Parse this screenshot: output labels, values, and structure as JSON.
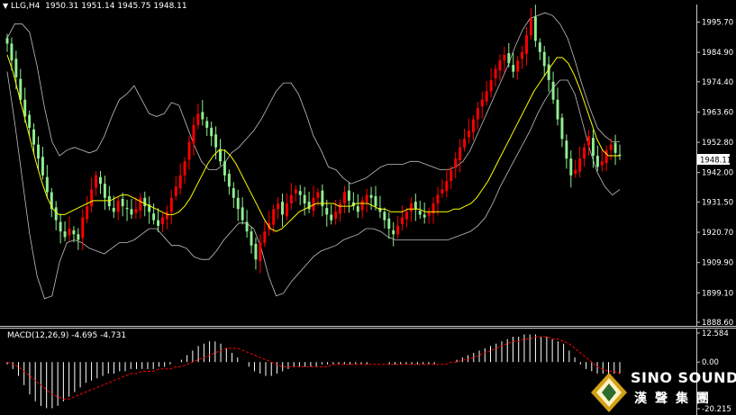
{
  "header": {
    "symbol": "LLG,H4",
    "ohlc": [
      "1950.31",
      "1951.14",
      "1945.75",
      "1948.11"
    ]
  },
  "macd": {
    "label": "MACD(12,26,9) -4.695 -4.731"
  },
  "current_price": "1948.11",
  "logo": {
    "title": "SINO SOUND",
    "subtitle": "漢聲集團"
  },
  "colors": {
    "background": "#000000",
    "bull_candle": "#ff0000",
    "bear_candle": "#90ee90",
    "ma_line": "#ffff00",
    "bollinger": "#c0c0c0",
    "macd_hist": "#ffffff",
    "macd_signal": "#ff0000"
  },
  "chart_data": [
    {
      "type": "candlestick",
      "title": "LLG,H4",
      "y_ticks": [
        "1995.70",
        "1984.90",
        "1974.40",
        "1963.60",
        "1952.80",
        "1942.00",
        "1931.50",
        "1920.70",
        "1909.90",
        "1899.10",
        "1888.60"
      ],
      "ylim": [
        1888.6,
        2001.0
      ],
      "x_labels": [],
      "series": [
        {
          "name": "Close",
          "values": [
            1988,
            1982,
            1976,
            1968,
            1962,
            1958,
            1952,
            1947,
            1941,
            1935,
            1929,
            1925,
            1921,
            1919,
            1922,
            1920,
            1918,
            1926,
            1930,
            1936,
            1941,
            1938,
            1933,
            1930,
            1928,
            1932,
            1930,
            1929,
            1927,
            1929,
            1933,
            1930,
            1928,
            1925,
            1923,
            1926,
            1928,
            1933,
            1937,
            1941,
            1946,
            1953,
            1959,
            1963,
            1961,
            1958,
            1955,
            1951,
            1946,
            1941,
            1937,
            1933,
            1929,
            1925,
            1921,
            1916,
            1911,
            1917,
            1921,
            1924,
            1929,
            1931,
            1927,
            1931,
            1934,
            1936,
            1934,
            1931,
            1929,
            1933,
            1935,
            1930,
            1927,
            1925,
            1928,
            1931,
            1935,
            1932,
            1930,
            1928,
            1932,
            1934,
            1933,
            1930,
            1928,
            1925,
            1922,
            1920,
            1923,
            1926,
            1928,
            1931,
            1929,
            1927,
            1926,
            1928,
            1931,
            1934,
            1936,
            1939,
            1943,
            1947,
            1951,
            1954,
            1957,
            1961,
            1965,
            1968,
            1971,
            1975,
            1979,
            1982,
            1984,
            1981,
            1978,
            1982,
            1985,
            1991,
            1997,
            1989,
            1985,
            1980,
            1975,
            1968,
            1961,
            1954,
            1947,
            1941,
            1943,
            1947,
            1951,
            1955,
            1948,
            1944,
            1946,
            1950,
            1952,
            1949,
            1948
          ]
        },
        {
          "name": "MA",
          "values": [
            1984,
            1978,
            1970,
            1962,
            1954,
            1946,
            1939,
            1933,
            1929,
            1927,
            1927,
            1928,
            1929,
            1930,
            1931,
            1932,
            1932,
            1932,
            1932,
            1933,
            1934,
            1934,
            1933,
            1932,
            1931,
            1930,
            1929,
            1928,
            1927,
            1927,
            1928,
            1930,
            1933,
            1937,
            1941,
            1945,
            1948,
            1950,
            1950,
            1948,
            1945,
            1941,
            1937,
            1933,
            1929,
            1925,
            1922,
            1921,
            1922,
            1924,
            1926,
            1928,
            1929,
            1930,
            1931,
            1931,
            1931,
            1931,
            1930,
            1930,
            1930,
            1931,
            1931,
            1931,
            1930,
            1929,
            1929,
            1928,
            1928,
            1928,
            1929,
            1929,
            1929,
            1928,
            1928,
            1928,
            1928,
            1928,
            1929,
            1929,
            1930,
            1931,
            1933,
            1936,
            1939,
            1943,
            1947,
            1951,
            1955,
            1959,
            1963,
            1967,
            1971,
            1974,
            1977,
            1980,
            1983,
            1983,
            1981,
            1977,
            1972,
            1966,
            1960,
            1954,
            1950,
            1948,
            1948,
            1948
          ]
        },
        {
          "name": "Bollinger upper",
          "values": [
            1990,
            1995,
            1995,
            1992,
            1980,
            1965,
            1953,
            1948,
            1950,
            1951,
            1950,
            1949,
            1950,
            1955,
            1962,
            1968,
            1970,
            1973,
            1968,
            1963,
            1962,
            1963,
            1967,
            1966,
            1959,
            1952,
            1946,
            1943,
            1943,
            1945,
            1949,
            1951,
            1954,
            1957,
            1961,
            1966,
            1971,
            1974,
            1974,
            1970,
            1963,
            1955,
            1950,
            1944,
            1943,
            1940,
            1938,
            1939,
            1940,
            1942,
            1944,
            1945,
            1945,
            1945,
            1946,
            1946,
            1945,
            1944,
            1943,
            1943,
            1944,
            1946,
            1950,
            1956,
            1962,
            1968,
            1974,
            1980,
            1987,
            1993,
            1997,
            1998,
            1999,
            1998,
            1995,
            1990,
            1982,
            1973,
            1965,
            1958,
            1955,
            1953,
            1953
          ]
        },
        {
          "name": "Bollinger lower",
          "values": [
            1978,
            1960,
            1940,
            1920,
            1905,
            1897,
            1898,
            1910,
            1917,
            1918,
            1917,
            1915,
            1914,
            1913,
            1915,
            1917,
            1917,
            1918,
            1920,
            1922,
            1922,
            1919,
            1916,
            1916,
            1915,
            1912,
            1911,
            1911,
            1914,
            1918,
            1921,
            1924,
            1924,
            1922,
            1915,
            1905,
            1898,
            1899,
            1903,
            1906,
            1909,
            1912,
            1914,
            1915,
            1916,
            1918,
            1919,
            1920,
            1922,
            1922,
            1921,
            1919,
            1918,
            1918,
            1918,
            1918,
            1918,
            1918,
            1918,
            1918,
            1919,
            1920,
            1921,
            1923,
            1926,
            1931,
            1937,
            1942,
            1947,
            1952,
            1957,
            1963,
            1968,
            1972,
            1975,
            1975,
            1970,
            1960,
            1950,
            1942,
            1937,
            1934,
            1936
          ]
        }
      ]
    },
    {
      "type": "bar",
      "title": "MACD(12,26,9) -4.695 -4.731",
      "y_ticks": [
        "12.584",
        "0.00",
        "-20.215"
      ],
      "ylim": [
        -20.215,
        12.584
      ],
      "series": [
        {
          "name": "MACD",
          "values": [
            -1,
            -3,
            -6,
            -10,
            -14,
            -17,
            -19,
            -20,
            -20,
            -19,
            -17,
            -15,
            -13,
            -11,
            -9,
            -8,
            -7,
            -6,
            -5,
            -5,
            -4,
            -4,
            -3,
            -3,
            -3,
            -3,
            -3,
            -2,
            -2,
            -1,
            0,
            1,
            3,
            5,
            7,
            8,
            9,
            9,
            8,
            6,
            4,
            2,
            0,
            -2,
            -4,
            -5,
            -6,
            -6,
            -5,
            -4,
            -3,
            -2,
            -2,
            -2,
            -2,
            -2,
            -1,
            -1,
            -1,
            -1,
            -1,
            -1,
            -1,
            -1,
            -1,
            0,
            0,
            0,
            -1,
            -1,
            -1,
            -1,
            -1,
            -1,
            -1,
            -1,
            -1,
            0,
            0,
            0,
            1,
            2,
            3,
            4,
            5,
            6,
            7,
            8,
            9,
            10,
            11,
            11,
            12,
            12,
            12,
            11,
            11,
            10,
            9,
            8,
            5,
            2,
            -1,
            -3,
            -4,
            -5,
            -5,
            -5,
            -5,
            -5
          ]
        },
        {
          "name": "Signal",
          "values": [
            0,
            -1,
            -2,
            -4,
            -6,
            -8,
            -10,
            -12,
            -14,
            -15,
            -16,
            -16,
            -15,
            -14,
            -13,
            -12,
            -11,
            -10,
            -9,
            -8,
            -7,
            -6,
            -5,
            -5,
            -4,
            -4,
            -4,
            -3,
            -3,
            -3,
            -2,
            -2,
            -1,
            0,
            1,
            2,
            3,
            4,
            5,
            6,
            6,
            6,
            5,
            4,
            3,
            2,
            1,
            0,
            -1,
            -2,
            -2,
            -2,
            -2,
            -2,
            -2,
            -2,
            -2,
            -2,
            -1,
            -1,
            -1,
            -1,
            -1,
            -1,
            -1,
            -1,
            -1,
            -1,
            -1,
            -1,
            -1,
            -1,
            -1,
            -1,
            -1,
            -1,
            -1,
            -1,
            -1,
            0,
            0,
            1,
            1,
            2,
            3,
            4,
            5,
            6,
            7,
            8,
            9,
            9,
            10,
            10,
            11,
            11,
            11,
            10,
            10,
            9,
            8,
            6,
            4,
            2,
            0,
            -2,
            -3,
            -4,
            -4,
            -5
          ]
        }
      ]
    }
  ]
}
